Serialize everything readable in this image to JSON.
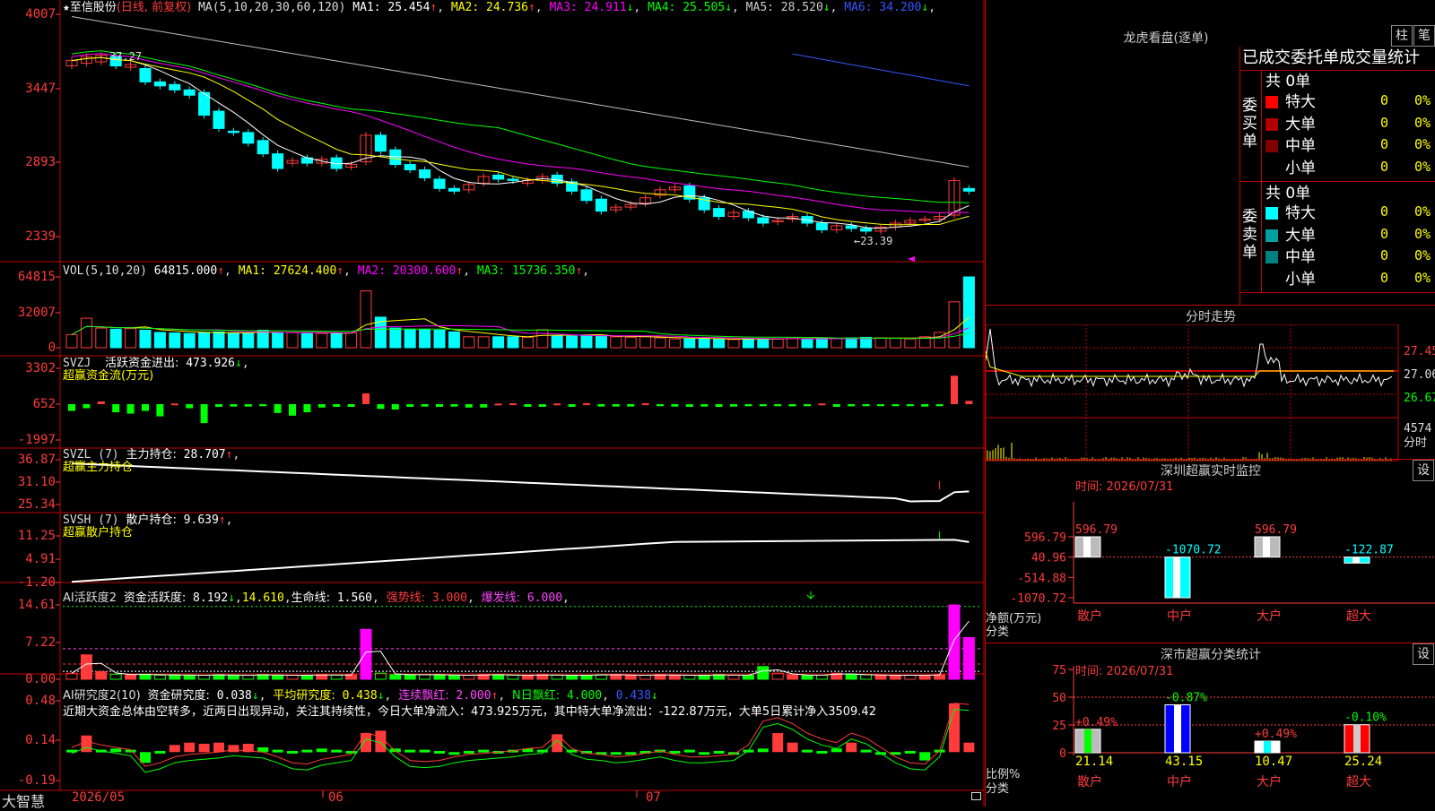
{
  "left": {
    "header": {
      "star": "★",
      "stock_name": "至信股份",
      "period": "(日线, 前复权)",
      "ma_params": "MA(5,10,20,30,60,120)",
      "ma": [
        {
          "label": "MA1:",
          "value": "25.454",
          "arrow": "↑",
          "color": "#ffffff"
        },
        {
          "label": "MA2:",
          "value": "24.736",
          "arrow": "↑",
          "color": "#ffff00"
        },
        {
          "label": "MA3:",
          "value": "24.911",
          "arrow": "↓",
          "color": "#ff00ff"
        },
        {
          "label": "MA4:",
          "value": "25.505",
          "arrow": "↓",
          "color": "#00ff00"
        },
        {
          "label": "MA5:",
          "value": "28.520",
          "arrow": "↓",
          "color": "#cccccc"
        },
        {
          "label": "MA6:",
          "value": "34.200",
          "arrow": "↓",
          "color": "#3355ff"
        }
      ],
      "high_mark": "37.27",
      "low_mark": "←23.39"
    },
    "axes": {
      "price": [
        "4007",
        "3447",
        "2893",
        "2339"
      ],
      "vol": [
        "64815",
        "32007",
        "0"
      ],
      "svzj": [
        "3302",
        "652",
        "-1997"
      ],
      "svzl": [
        "36.87",
        "31.10",
        "25.34"
      ],
      "svsh": [
        "11.25",
        "4.91",
        "-1.20"
      ],
      "ai1": [
        "14.61",
        "7.22",
        "0.00"
      ],
      "ai2": [
        "0.48",
        "0.14",
        "-0.19"
      ]
    },
    "vol_header": {
      "name": "VOL(5,10,20)",
      "value": "64815.000",
      "arrow": "↑",
      "ma": [
        {
          "label": "MA1:",
          "value": "27624.400",
          "arrow": "↑",
          "color": "#ffff00"
        },
        {
          "label": "MA2:",
          "value": "20300.600",
          "arrow": "↑",
          "color": "#ff00ff"
        },
        {
          "label": "MA3:",
          "value": "15736.350",
          "arrow": "↑",
          "color": "#00ff00"
        }
      ]
    },
    "svzj_header": {
      "name": "SVZJ",
      "title": "活跃资金进出:",
      "value": "473.926",
      "arrow": "↓",
      "subtitle": "超赢资金流(万元)"
    },
    "svzl_header": {
      "name": "SVZL (7)",
      "title": "主力持仓:",
      "value": "28.707",
      "arrow": "↑",
      "subtitle": "超赢主力持仓"
    },
    "svsh_header": {
      "name": "SVSH (7)",
      "title": "散户持仓:",
      "value": "9.639",
      "arrow": "↑",
      "subtitle": "超赢散户持仓"
    },
    "ai1_header": {
      "name": "AI活跃度2",
      "title": "资金活跃度:",
      "value": "8.192",
      "arrow": "↓",
      "v2": "14.610",
      "life_label": "生命线:",
      "life": "1.560",
      "strong_label": "强势线:",
      "strong": "3.000",
      "burst_label": "爆发线:",
      "burst": "6.000"
    },
    "ai2_header": {
      "name": "AI研究度2(10)",
      "title": "资金研究度:",
      "value": "0.038",
      "arrow": "↓",
      "avg_label": "平均研究度:",
      "avg": "0.438",
      "avg_arrow": "↓",
      "red_label": "连续飘红:",
      "red": "2.000",
      "red_arrow": "↑",
      "nred_label": "N日飘红:",
      "nred": "4.000",
      "last": "0.438",
      "last_arrow": "↓"
    },
    "comment": "近期大资金总体由空转多，近两日出现异动，关注其持续性，今日大单净流入：473.925万元，其中特大单净流出：-122.87万元，大单5日累计净入3509.42",
    "footer": {
      "brand": "大智慧",
      "dates": [
        "2026/05",
        "06",
        "07"
      ]
    }
  },
  "right": {
    "dragon": {
      "title": "龙虎看盘(逐单)",
      "btn1": "柱",
      "btn2": "笔",
      "tabs": "已成交委托单成交量统计",
      "buy_label": "委买单",
      "sell_label": "委卖单",
      "buy_total": "共 0单",
      "sell_total": "共 0单",
      "buy_rows": [
        {
          "name": "特大",
          "count": "0",
          "pct": "0%",
          "color": "#ff0000"
        },
        {
          "name": "大单",
          "count": "0",
          "pct": "0%",
          "color": "#b00000"
        },
        {
          "name": "中单",
          "count": "0",
          "pct": "0%",
          "color": "#800000"
        },
        {
          "name": "小单",
          "count": "0",
          "pct": "0%",
          "color": "#000000"
        }
      ],
      "sell_rows": [
        {
          "name": "特大",
          "count": "0",
          "pct": "0%",
          "color": "#00ffff"
        },
        {
          "name": "大单",
          "count": "0",
          "pct": "0%",
          "color": "#00a0a0"
        },
        {
          "name": "中单",
          "count": "0",
          "pct": "0%",
          "color": "#008080"
        },
        {
          "name": "小单",
          "count": "0",
          "pct": "0%",
          "color": "#000000"
        }
      ]
    },
    "intraday": {
      "title": "分时走势",
      "axis": [
        "27.45",
        "27.06",
        "26.67",
        "4574"
      ],
      "vol_label": "分时"
    },
    "monitor": {
      "title": "深圳超赢实时监控",
      "btn": "设",
      "time": "时间: 2026/07/31",
      "axis": [
        "596.79",
        "40.96",
        "-514.88",
        "-1070.72"
      ],
      "ylabel": "净额(万元)",
      "xlabel": "分类",
      "categories": [
        "散户",
        "中户",
        "大户",
        "超大"
      ],
      "values": [
        "596.79",
        "-1070.72",
        "596.79",
        "-122.87"
      ]
    },
    "stats": {
      "title": "深市超赢分类统计",
      "btn": "设",
      "time": "时间: 2026/07/31",
      "axis": [
        "75",
        "50",
        "25",
        "0"
      ],
      "ylabel": "比例%",
      "xlabel": "分类",
      "categories": [
        "散户",
        "中户",
        "大户",
        "超大"
      ],
      "top": [
        "+0.49%",
        "-0.87%",
        "+0.49%",
        "-0.10%"
      ],
      "bottom": [
        "21.14",
        "43.15",
        "10.47",
        "25.24"
      ]
    }
  }
}
